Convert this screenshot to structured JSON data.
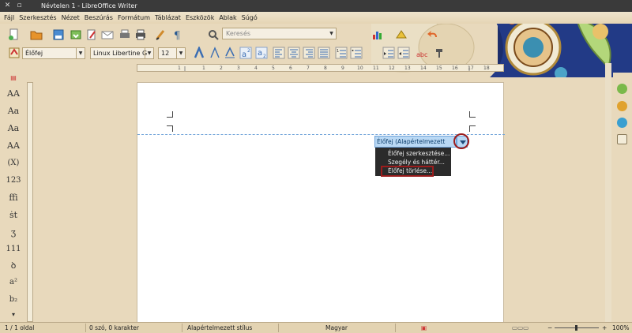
{
  "window": {
    "title": "Névtelen 1 - LibreOffice Writer"
  },
  "menu": [
    "Fájl",
    "Szerkesztés",
    "Nézet",
    "Beszúrás",
    "Formátum",
    "Táblázat",
    "Eszközök",
    "Ablak",
    "Súgó"
  ],
  "search": {
    "placeholder": "Keresés"
  },
  "formatting": {
    "paragraph_style": "Élőfej",
    "font_name": "Linux Libertine G",
    "font_size": "12"
  },
  "ruler": {
    "labels": [
      "1",
      "1",
      "2",
      "3",
      "4",
      "5",
      "6",
      "7",
      "8",
      "9",
      "10",
      "11",
      "12",
      "13",
      "14",
      "15",
      "16",
      "17",
      "18"
    ]
  },
  "header_tag": {
    "label": "Élőfej (Alapértelmezett stílus)"
  },
  "header_menu": [
    "Élőfej szerkesztése...",
    "Szegély és háttér...",
    "Élőfej törlése..."
  ],
  "left_sidebar": [
    "AA",
    "Aa",
    "Aa",
    "AA",
    "(X)",
    "123",
    "ffi",
    "ṡt",
    "ʒ",
    "111",
    "ꝺ",
    "a²",
    "b₂"
  ],
  "status": {
    "page": "1 / 1 oldal",
    "words": "0 szó, 0 karakter",
    "style": "Alapértelmezett stílus",
    "language": "Magyar",
    "zoom": "100%"
  },
  "colors": {
    "accent": "#9b1c1c",
    "header_blue": "#b9d8f4",
    "theme_bg": "#e8d9bc"
  }
}
